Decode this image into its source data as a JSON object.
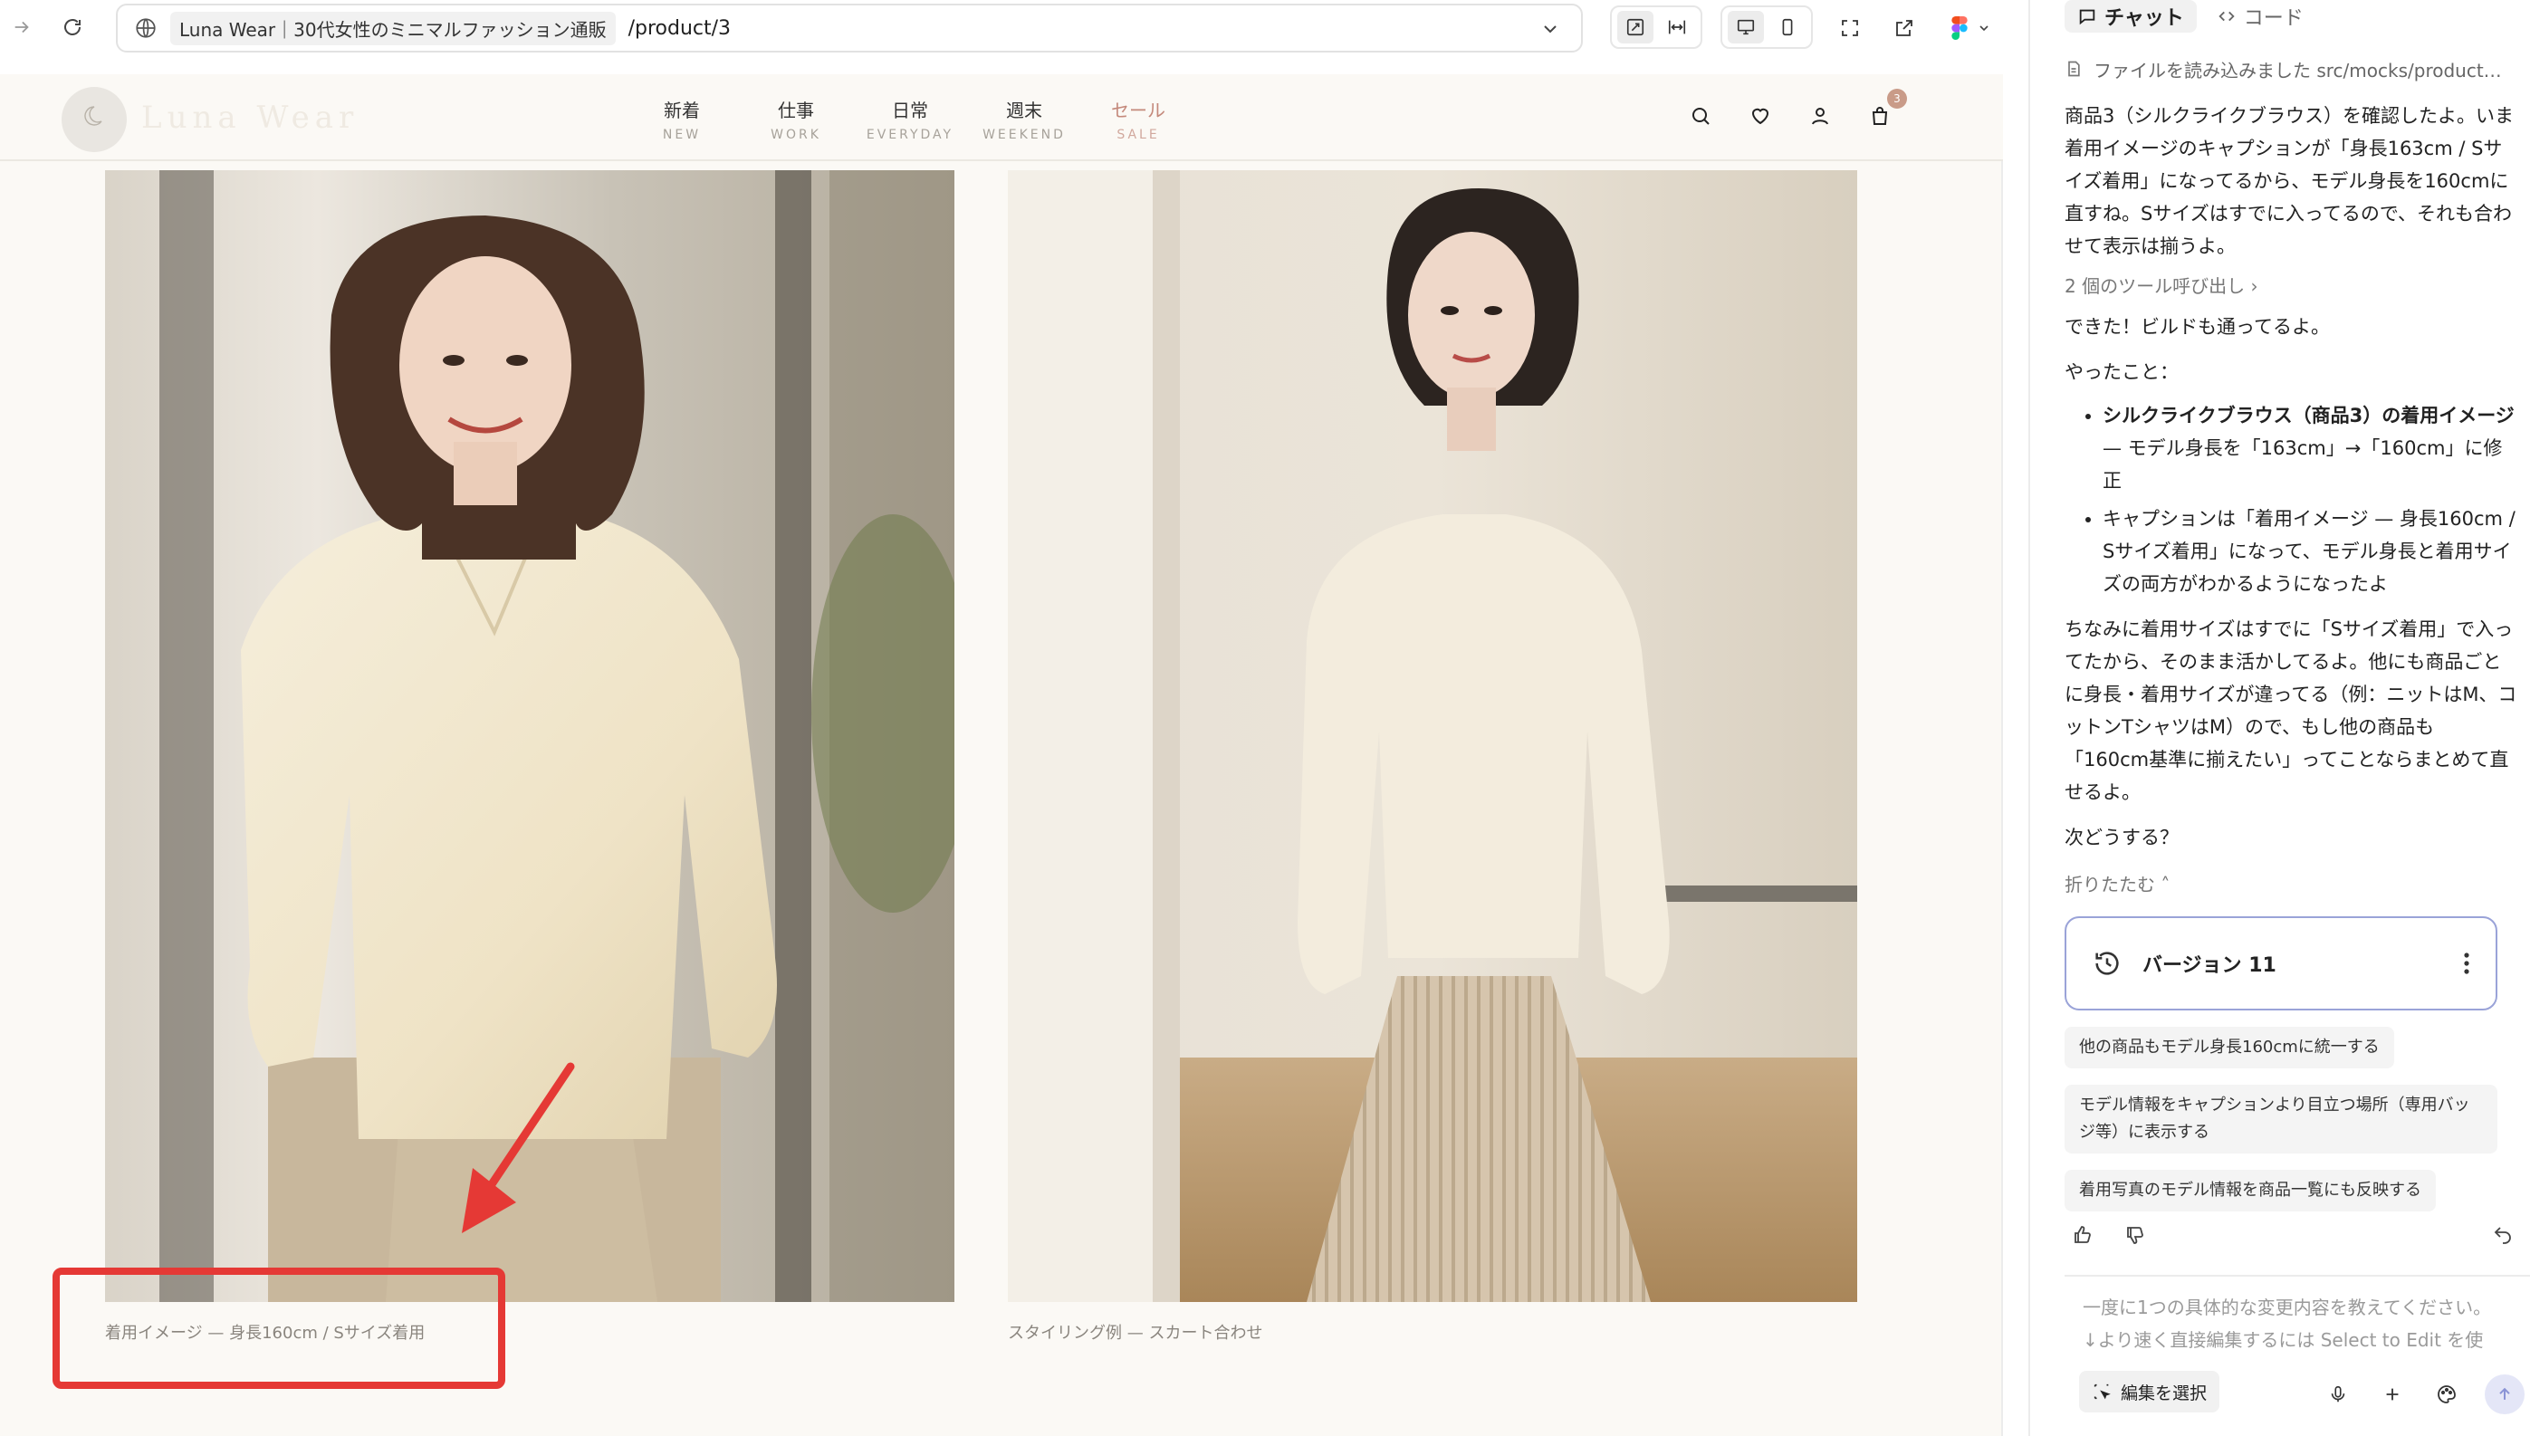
{
  "browser": {
    "site_chip": "Luna Wear｜30代女性のミニマルファッション通販",
    "url_path": "/product/3"
  },
  "site": {
    "logo_text": "Luna Wear",
    "nav": [
      {
        "jp": "新着",
        "en": "NEW"
      },
      {
        "jp": "仕事",
        "en": "WORK"
      },
      {
        "jp": "日常",
        "en": "EVERYDAY"
      },
      {
        "jp": "週末",
        "en": "WEEKEND"
      },
      {
        "jp": "セール",
        "en": "SALE"
      }
    ],
    "cart_count": "3"
  },
  "product": {
    "caption_left": "着用イメージ — 身長160cm / Sサイズ着用",
    "caption_right": "スタイリング例 — スカート合わせ"
  },
  "chat": {
    "tabs": [
      "チャット",
      "コード"
    ],
    "file_read": "ファイルを読み込みました  src/mocks/product…",
    "msg1": "商品3（シルクライクブラウス）を確認したよ。いま着用イメージのキャプションが「身長163cm / Sサイズ着用」になってるから、モデル身長を160cmに直すね。Sサイズはすでに入ってるので、それも合わせて表示は揃うよ。",
    "tool_calls": "2 個のツール呼び出し ›",
    "msg2": "できた！ビルドも通ってるよ。",
    "msg3": "やったこと：",
    "bullet1_bold": "シルクライクブラウス（商品3）の着用イメージ",
    "bullet1_rest": " — モデル身長を「163cm」→「160cm」に修正",
    "bullet2": "キャプションは「着用イメージ — 身長160cm / Sサイズ着用」になって、モデル身長と着用サイズの両方がわかるようになったよ",
    "msg4": "ちなみに着用サイズはすでに「Sサイズ着用」で入ってたから、そのまま活かしてるよ。他にも商品ごとに身長・着用サイズが違ってる（例：ニットはM、コットンTシャツはM）ので、もし他の商品も「160cm基準に揃えたい」ってことならまとめて直せるよ。",
    "msg5": "次どうする？",
    "collapse": "折りたたむ ˄",
    "version": "バージョン 11",
    "suggestions": [
      "他の商品もモデル身長160cmに統一する",
      "モデル情報をキャプションより目立つ場所（専用バッジ等）に表示する",
      "着用写真のモデル情報を商品一覧にも反映する"
    ],
    "input_line1": "一度に1つの具体的な変更内容を教えてください。",
    "input_line2": "↓より速く直接編集するには Select to Edit を使",
    "select_edit": "編集を選択"
  }
}
